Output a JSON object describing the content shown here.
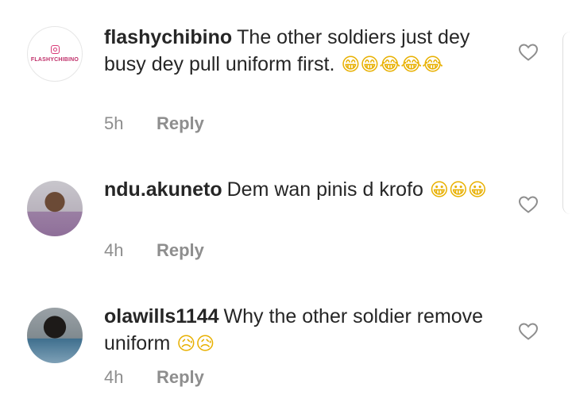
{
  "comments": [
    {
      "username": "flashychibino",
      "text": "The other soldiers just dey busy dey pull uniform first.",
      "emojis": "😁😁😂😂😂",
      "time": "5h",
      "reply": "Reply",
      "avatar_label": "FLASHYCHIBINO"
    },
    {
      "username": "ndu.akuneto",
      "text": "Dem wan pinis d krofo",
      "emojis": "😀😀😀",
      "time": "4h",
      "reply": "Reply"
    },
    {
      "username": "olawills1144",
      "text": "Why the other soldier remove uniform",
      "emojis": "😥😥",
      "time": "4h",
      "reply": "Reply"
    }
  ],
  "icons": {
    "like": "heart-outline-icon",
    "brand": "instagram-glyph-icon"
  }
}
